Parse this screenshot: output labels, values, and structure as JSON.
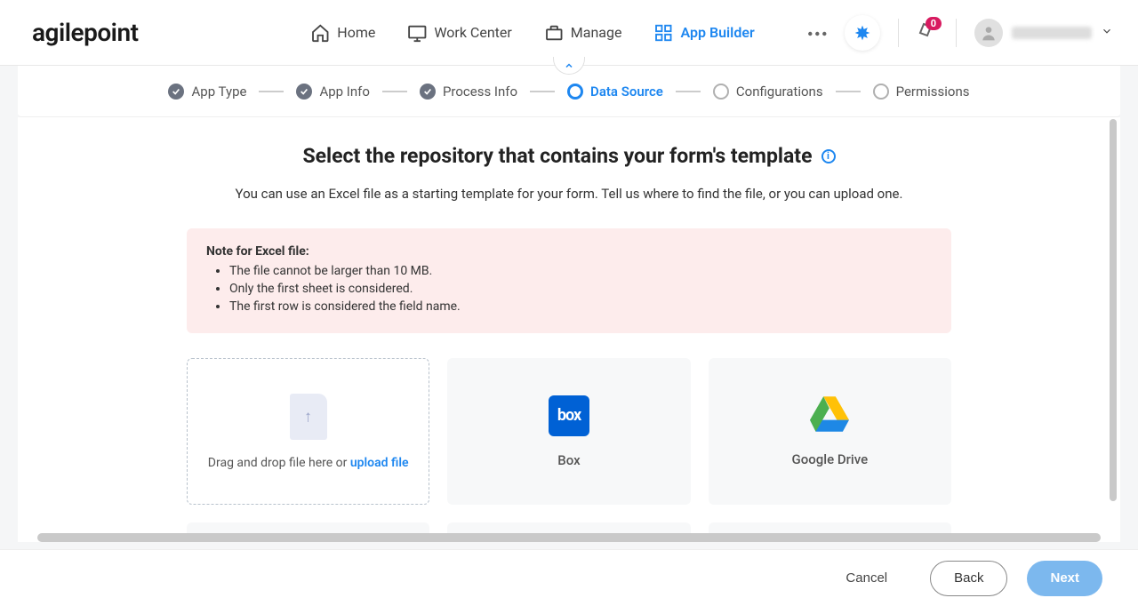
{
  "brand": "agilepoint",
  "nav": {
    "items": [
      {
        "label": "Home",
        "icon": "home-icon"
      },
      {
        "label": "Work Center",
        "icon": "monitor-icon"
      },
      {
        "label": "Manage",
        "icon": "briefcase-icon"
      },
      {
        "label": "App Builder",
        "icon": "grid-icon",
        "active": true
      }
    ]
  },
  "notifications_count": "0",
  "wizard": {
    "steps": [
      {
        "label": "App Type",
        "state": "done"
      },
      {
        "label": "App Info",
        "state": "done"
      },
      {
        "label": "Process Info",
        "state": "done"
      },
      {
        "label": "Data Source",
        "state": "current"
      },
      {
        "label": "Configurations",
        "state": "pending"
      },
      {
        "label": "Permissions",
        "state": "pending"
      }
    ]
  },
  "page": {
    "title": "Select the repository that contains your form's template",
    "subtitle": "You can use an Excel file as a starting template for your form. Tell us where to find the file, or you can upload one."
  },
  "note": {
    "heading": "Note for Excel file:",
    "items": [
      "The file cannot be larger than 10 MB.",
      "Only the first sheet is considered.",
      "The first row is considered the field name."
    ]
  },
  "upload": {
    "prefix": "Drag and drop file here or ",
    "link": "upload file"
  },
  "repos": [
    {
      "label": "Box"
    },
    {
      "label": "Google Drive"
    }
  ],
  "footer": {
    "cancel": "Cancel",
    "back": "Back",
    "next": "Next"
  }
}
